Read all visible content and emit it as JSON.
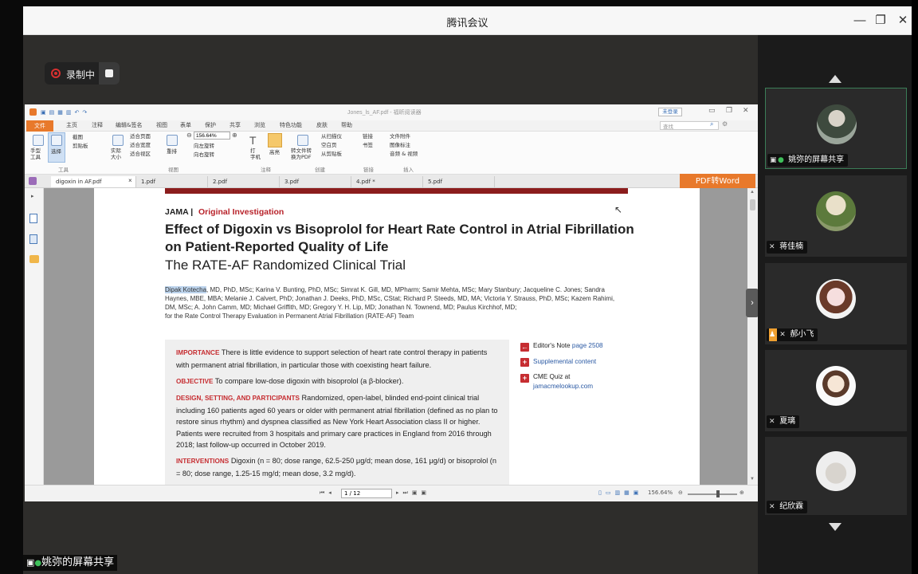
{
  "window": {
    "title": "腾讯会议"
  },
  "recording": {
    "label": "录制中"
  },
  "app": {
    "menus": [
      "文件",
      "主页",
      "注释",
      "编辑&签名",
      "视图",
      "表单",
      "保护",
      "共享",
      "浏览",
      "特色功能",
      "皮肤",
      "帮助"
    ],
    "ribbon": {
      "hand_tool": "手型\n工具",
      "select_tool": "选择",
      "screenshot": "截图",
      "clipboard": "剪贴板",
      "actual_size": "实际\n大小",
      "fit_page": "适合页面",
      "fit_width": "适合宽度",
      "fit_visible": "适合视区",
      "zoom_value": "156.64%",
      "reflow": "重排",
      "rotate_left": "向左旋转",
      "rotate_right": "向右旋转",
      "typewriter": "打\n字机",
      "highlight": "高亮",
      "to_pdf": "转文件转\n换为PDF",
      "from_scanner": "从扫描仪",
      "blank_page": "空白页",
      "from_clipboard": "从剪贴板",
      "link": "链接",
      "bookmark": "书签",
      "attachment": "文件附件",
      "image_annot": "图像标注",
      "audio_video": "音频 & 视频",
      "groups": {
        "tools": "工具",
        "view": "视图",
        "comment": "注释",
        "create": "创建",
        "links": "链接",
        "insert": "插入"
      },
      "login": "未登录",
      "search_placeholder": "查找"
    },
    "doc_title": "Jones_ls_AF.pdf - 福昕阅读器",
    "tabs": [
      "digoxin in AF.pdf",
      "1.pdf",
      "2.pdf",
      "3.pdf",
      "4.pdf *",
      "5.pdf"
    ],
    "pdf_to_word": "PDF转Word",
    "status": {
      "page_field": "1 / 12",
      "zoom": "156.64%"
    }
  },
  "article": {
    "journal": "JAMA",
    "section": "Original Investigation",
    "title_line1": "Effect of Digoxin vs Bisoprolol for Heart Rate Control in Atrial Fibrillation",
    "title_line2": "on Patient-Reported Quality of Life",
    "subtitle": "The RATE-AF Randomized Clinical Trial",
    "author_highlight": "Dipak Kotecha",
    "authors_rest": ", MD, PhD, MSc; Karina V. Bunting, PhD, MSc; Simrat K. Gill, MD, MPharm; Samir Mehta, MSc; Mary Stanbury; Jacqueline C. Jones; Sandra Haynes, MBE, MBA; Melanie J. Calvert, PhD; Jonathan J. Deeks, PhD, MSc, CStat; Richard P. Steeds, MD, MA; Victoria Y. Strauss, PhD, MSc; Kazem Rahimi, DM, MSc; A. John Camm, MD; Michael Griffith, MD; Gregory Y. H. Lip, MD; Jonathan N. Townend, MD; Paulus Kirchhof, MD;",
    "authors_group": "for the Rate Control Therapy Evaluation in Permanent Atrial Fibrillation (RATE-AF) Team",
    "importance_label": "IMPORTANCE",
    "importance": "There is little evidence to support selection of heart rate control therapy in patients with permanent atrial fibrillation, in particular those with coexisting heart failure.",
    "objective_label": "OBJECTIVE",
    "objective": "To compare low-dose digoxin with bisoprolol (a β-blocker).",
    "design_label": "DESIGN, SETTING, AND PARTICIPANTS",
    "design": "Randomized, open-label, blinded end-point clinical trial including 160 patients aged 60 years or older with permanent atrial fibrillation (defined as no plan to restore sinus rhythm) and dyspnea classified as New York Heart Association class II or higher. Patients were recruited from 3 hospitals and primary care practices in England from 2016 through 2018; last follow-up occurred in October 2019.",
    "interventions_label": "INTERVENTIONS",
    "interventions": "Digoxin (n = 80; dose range, 62.5-250 μg/d; mean dose, 161 μg/d) or bisoprolol (n = 80; dose range, 1.25-15 mg/d; mean dose, 3.2 mg/d).",
    "editors_note": "Editor's Note",
    "editors_note_page": "page 2508",
    "supplemental": "Supplemental content",
    "cme_quiz": "CME Quiz",
    "cme_at": "at",
    "cme_link": "jamacmelookup.com"
  },
  "participants": [
    {
      "name": "姚弥的屏幕共享",
      "active": true
    },
    {
      "name": "蒋佳楠",
      "active": false
    },
    {
      "name": "郝小飞",
      "active": false
    },
    {
      "name": "夏璃",
      "active": false
    },
    {
      "name": "纪欣霖",
      "active": false
    }
  ],
  "bottom_share_label": "姚弥的屏幕共享",
  "colors": {
    "accent_orange": "#e8792b",
    "jama_red": "#b8232b",
    "record_red": "#d83030"
  }
}
